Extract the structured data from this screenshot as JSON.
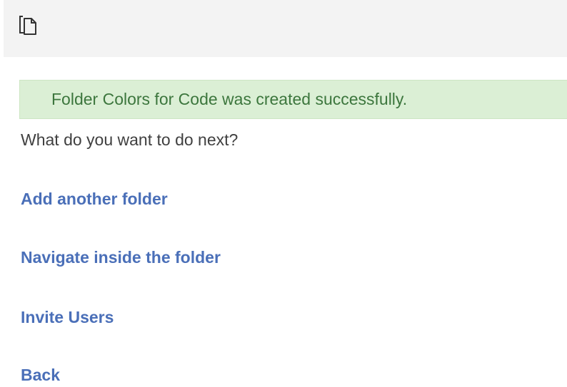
{
  "header": {
    "icon": "copy-icon"
  },
  "alert": {
    "message": "Folder Colors for Code was created successfully."
  },
  "prompt": "What do you want to do next?",
  "actions": [
    {
      "label": "Add another folder"
    },
    {
      "label": "Navigate inside the folder"
    },
    {
      "label": "Invite Users"
    },
    {
      "label": "Back"
    }
  ],
  "colors": {
    "link": "#4a6fb8",
    "alert_bg": "#dbefd5",
    "alert_text": "#3c763d",
    "topbar_bg": "#f3f3f3"
  }
}
